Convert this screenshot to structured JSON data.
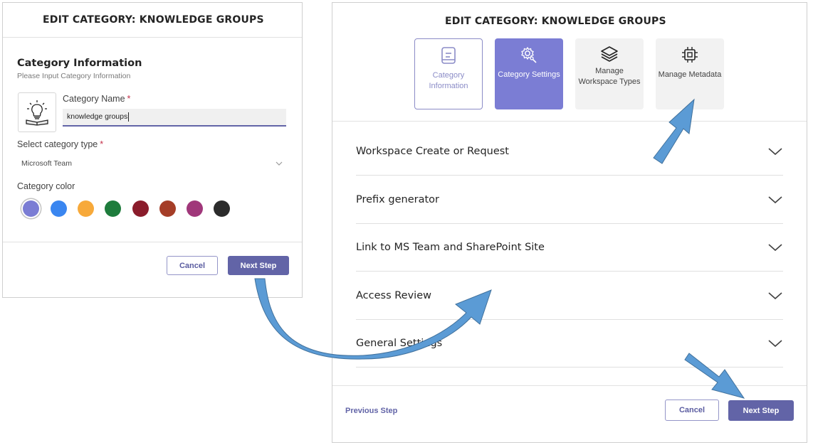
{
  "left_dialog": {
    "title": "EDIT CATEGORY: KNOWLEDGE GROUPS",
    "section_title": "Category Information",
    "section_subtitle": "Please Input Category Information",
    "category_icon": "lightbulb-book-icon",
    "name_label": "Category Name",
    "name_value": "knowledge groups",
    "required_mark": "*",
    "type_label": "Select category type",
    "type_value": "Microsoft Team",
    "color_label": "Category color",
    "colors": [
      "#7b7dd4",
      "#3a86f0",
      "#f7a93a",
      "#1e7c3c",
      "#8a1c2b",
      "#a53d27",
      "#a0377a",
      "#2b2b2b"
    ],
    "selected_color_index": 0,
    "cancel_label": "Cancel",
    "next_label": "Next Step"
  },
  "right_dialog": {
    "title": "EDIT CATEGORY: KNOWLEDGE GROUPS",
    "steps": [
      {
        "label": "Category Information",
        "icon": "clipboard-icon",
        "state": "done"
      },
      {
        "label": "Category Settings",
        "icon": "gear-icon",
        "state": "active"
      },
      {
        "label": "Manage Workspace Types",
        "icon": "layers-icon",
        "state": "pending"
      },
      {
        "label": "Manage Metadata",
        "icon": "chip-icon",
        "state": "pending"
      }
    ],
    "accordion": [
      {
        "label": "Workspace Create or Request"
      },
      {
        "label": "Prefix generator"
      },
      {
        "label": "Link to MS Team and SharePoint Site"
      },
      {
        "label": "Access Review"
      },
      {
        "label": "General Settings"
      }
    ],
    "previous_label": "Previous Step",
    "cancel_label": "Cancel",
    "next_label": "Next Step"
  },
  "colors": {
    "accent": "#6264a7",
    "arrow_fill": "#5b9bd5",
    "arrow_stroke": "#41719c"
  }
}
